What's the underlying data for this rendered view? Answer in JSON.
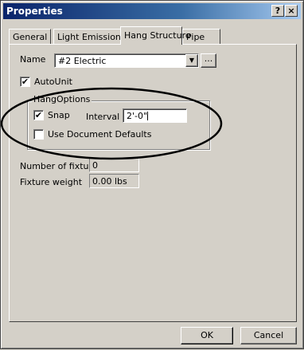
{
  "window": {
    "title": "Properties",
    "help_label": "?",
    "close_label": "×"
  },
  "tabs": [
    {
      "label": "General"
    },
    {
      "label": "Light Emission"
    },
    {
      "label": "Hang Structure"
    },
    {
      "label": "Pipe"
    }
  ],
  "form": {
    "name_label": "Name",
    "name_value": "#2 Electric",
    "dropdown_glyph": "▼",
    "browse_label": "...",
    "auto_unit_label": "AutoUnit",
    "auto_unit_checked": "✔",
    "hang_options": {
      "legend": "HangOptions",
      "snap_label": "Snap",
      "snap_checked": "✔",
      "interval_label": "Interval",
      "interval_value": "2'-0\"",
      "use_defaults_label": "Use Document Defaults"
    },
    "fixtures_label": "Number of fixtures",
    "fixtures_value": "0",
    "weight_label": "Fixture weight",
    "weight_value": "0.00 lbs"
  },
  "buttons": {
    "ok": "OK",
    "cancel": "Cancel"
  }
}
